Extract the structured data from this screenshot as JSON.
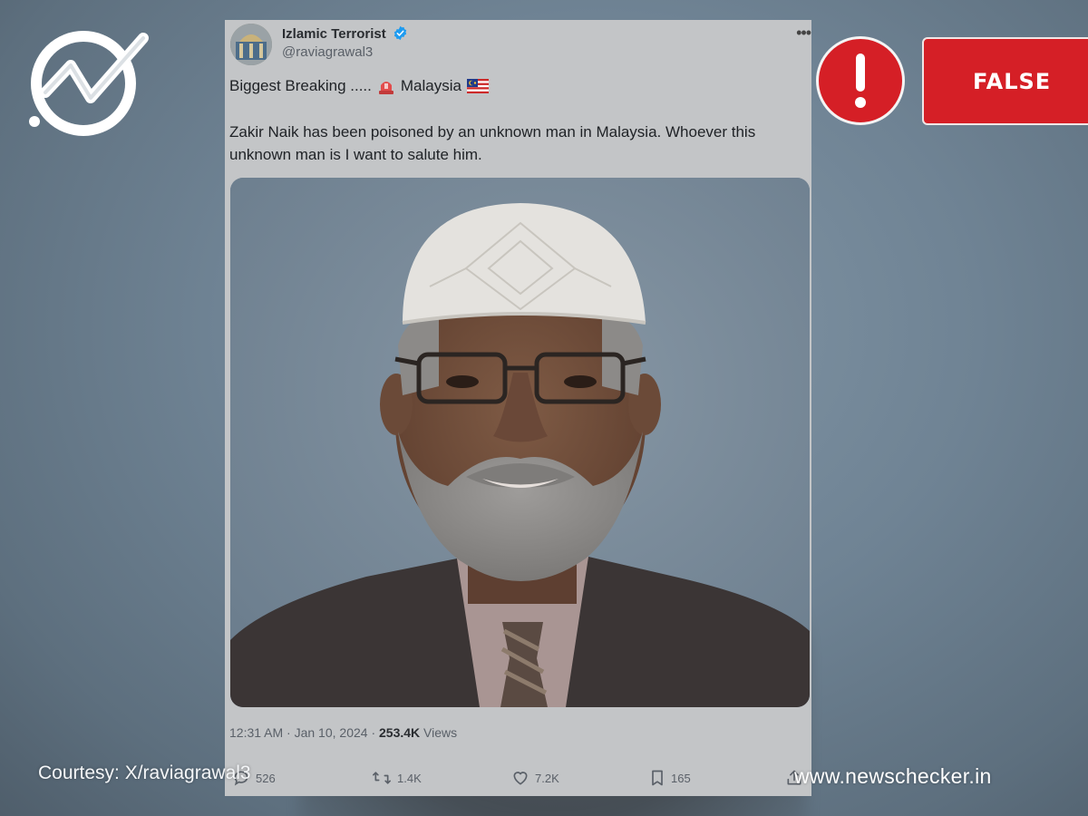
{
  "brand": {
    "logo_icon": "newschecker-check-logo-icon",
    "website": "www.newschecker.in",
    "courtesy": "Courtesy: X/raviagrawal3"
  },
  "verdict": {
    "icon": "exclamation-icon",
    "label": "FALSE",
    "color": "#d51f26"
  },
  "tweet": {
    "display_name": "Izlamic Terrorist",
    "handle": "@raviagrawal3",
    "verified_icon": "verified-badge-icon",
    "more_icon": "more-options-icon",
    "headline_prefix": "Biggest Breaking .....",
    "headline_emoji_1": "rotating-light-icon",
    "headline_country": "Malaysia",
    "headline_emoji_2": "malaysia-flag-icon",
    "body": "Zakir Naik has been poisoned by an unknown man in Malaysia. Whoever this unknown man is I want to salute him.",
    "media_icon": "portrait-photo-image",
    "timestamp": "12:31 AM · Jan 10, 2024 · ",
    "views_count": "253.4K",
    "views_label": "Views",
    "actions": {
      "replies": "526",
      "reposts": "1.4K",
      "likes": "7.2K",
      "bookmarks": "165"
    }
  }
}
